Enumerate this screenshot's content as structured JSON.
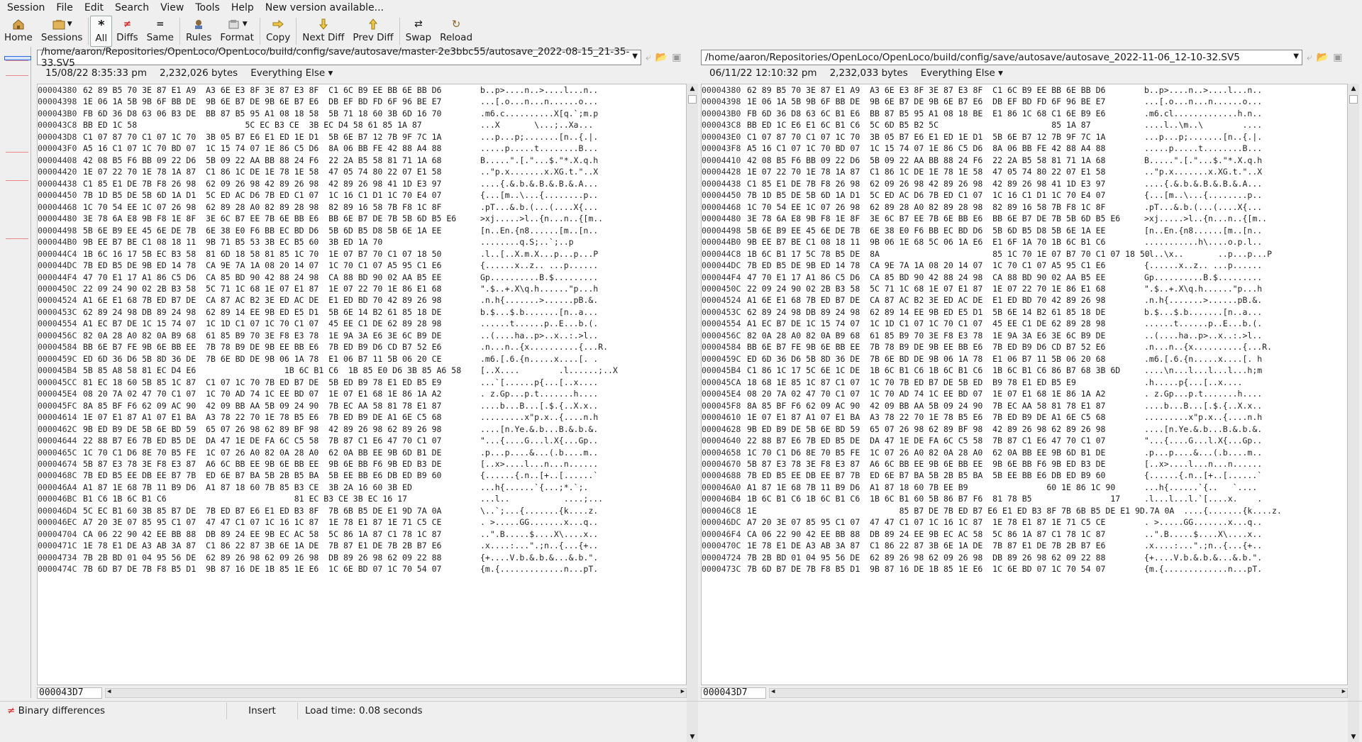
{
  "menu": {
    "items": [
      "Session",
      "File",
      "Edit",
      "Search",
      "View",
      "Tools",
      "Help",
      "New version available..."
    ]
  },
  "toolbar": {
    "buttons": [
      {
        "label": "Home",
        "icon": "house-icon"
      },
      {
        "label": "Sessions",
        "icon": "sessions-icon"
      },
      {
        "label": "All",
        "icon": "asterisk-icon"
      },
      {
        "label": "Diffs",
        "icon": "diffs-icon"
      },
      {
        "label": "Same",
        "icon": "equals-icon"
      },
      {
        "label": "Rules",
        "icon": "rules-icon"
      },
      {
        "label": "Format",
        "icon": "format-icon"
      },
      {
        "label": "Copy",
        "icon": "copy-arrow-icon"
      },
      {
        "label": "Next Diff",
        "icon": "next-diff-icon"
      },
      {
        "label": "Prev Diff",
        "icon": "prev-diff-icon"
      },
      {
        "label": "Swap",
        "icon": "swap-icon"
      },
      {
        "label": "Reload",
        "icon": "reload-icon"
      }
    ],
    "active": "All"
  },
  "left": {
    "path": "/home/aaron/Repositories/OpenLoco/OpenLoco/build/config/save/autosave/master-2e3bbc55/autosave_2022-08-15_21-35-33.SV5",
    "date": "15/08/22 8:35:33 pm",
    "size": "2,232,026 bytes",
    "filter": "Everything Else",
    "offset": "000043D7",
    "rows": [
      [
        "00004380",
        "62 89 B5 70 3E 87 E1 A9  A3 6E E3 8F 3E 87 E3 8F  C1 6C B9 EE BB 6E BB D6",
        "b..p>....n..>....l...n.."
      ],
      [
        "00004398",
        "1E 06 1A 5B 9B 6F BB DE  9B 6E B7 DE 9B 6E B7 E6  DB EF BD FD 6F 96 BE E7",
        "...[.o...n...n......o..."
      ],
      [
        "000043B0",
        "FB 6D 36 D8 63 06 B3 DE  BB 87 B5 95 A1 08 18 58  5B 71 18 60 3B 6D 16 70",
        ".m6.c..........X[q.`;m.p"
      ],
      [
        "000043C8",
        "BB ED 1C 58                      5C EC B3 CE  3B EC D4 58 61 85 1A 87",
        "...X       \\...;..Xa..."
      ],
      [
        "000043D8",
        "C1 07 87 70 C1 07 1C 70  3B 05 B7 E6 E1 ED 1E D1  5B 6E B7 12 7B 9F 7C 1A",
        "...p...p;.......[n..{.|."
      ],
      [
        "000043F0",
        "A5 16 C1 07 1C 70 BD 07  1C 15 74 07 1E 86 C5 D6  8A 06 BB FE 42 88 A4 88",
        ".....p.....t........B..."
      ],
      [
        "00004408",
        "42 08 B5 F6 BB 09 22 D6  5B 09 22 AA BB 88 24 F6  22 2A B5 58 81 71 1A 68",
        "B.....\".[.\"...$.\"*.X.q.h"
      ],
      [
        "00004420",
        "1E 07 22 70 1E 78 1A 87  C1 86 1C DE 1E 78 1E 58  47 05 74 80 22 07 E1 58",
        "..\"p.x.......x.XG.t.\"..X"
      ],
      [
        "00004438",
        "C1 85 E1 DE 7B F8 26 98  62 09 26 98 42 89 26 98  42 89 26 98 41 1D E3 97",
        "....{.&.b.&.B.&.B.&.A..."
      ],
      [
        "00004450",
        "7B 1D B5 DE 5B 6D 1A D1  5C ED AC D6 7B ED C1 07  1C 16 C1 D1 1C 70 E4 07",
        "{...[m..\\...{........p.."
      ],
      [
        "00004468",
        "1C 70 54 EE 1C 07 26 98  62 89 28 A0 82 89 28 98  82 89 16 58 7B F8 1C 8F",
        ".pT...&.b.(...(....X{..."
      ],
      [
        "00004480",
        "3E 78 6A E8 9B F8 1E 8F  3E 6C B7 EE 7B 6E BB E6  BB 6E B7 DE 7B 5B 6D B5 E6",
        ">xj.....>l..{n...n..{[m.."
      ],
      [
        "00004498",
        "5B 6E B9 EE 45 6E DE 7B  6E 38 E0 F6 BB EC BD D6  5B 6D B5 D8 5B 6E 1A EE",
        "[n..En.{n8......[m..[n.."
      ],
      [
        "000044B0",
        "9B EE B7 BE C1 08 18 11  9B 71 B5 53 3B EC B5 60  3B ED 1A 70",
        "........q.S;..`;..p"
      ],
      [
        "000044C4",
        "1B 6C 16 17 5B EC B3 58  81 6D 18 58 81 85 1C 70  1E 07 B7 70 C1 07 18 50",
        ".l..[..X.m.X...p...p...P"
      ],
      [
        "000044DC",
        "7B ED B5 DE 9B ED 14 78  CA 9E 7A 1A 08 20 14 07  1C 70 C1 07 A5 95 C1 E6",
        "{......x..z.. ...p......"
      ],
      [
        "000044F4",
        "47 70 E1 17 A1 86 C5 D6  CA 85 BD 90 42 88 24 98  CA 88 BD 90 02 AA B5 EE",
        "Gp..........B.$........."
      ],
      [
        "0000450C",
        "22 09 24 90 02 2B B3 58  5C 71 1C 68 1E 07 E1 87  1E 07 22 70 1E 86 E1 68",
        "\".$..+.X\\q.h......\"p...h"
      ],
      [
        "00004524",
        "A1 6E E1 68 7B ED B7 DE  CA 87 AC B2 3E ED AC DE  E1 ED BD 70 42 89 26 98",
        ".n.h{.......>......pB.&."
      ],
      [
        "0000453C",
        "62 89 24 98 DB 89 24 98  62 89 14 EE 9B ED E5 D1  5B 6E 14 B2 61 85 18 DE",
        "b.$...$.b.......[n..a..."
      ],
      [
        "00004554",
        "A1 EC B7 DE 1C 15 74 07  1C 1D C1 07 1C 70 C1 07  45 EE C1 DE 62 89 28 98",
        "......t......p..E...b.(."
      ],
      [
        "0000456C",
        "82 0A 28 A0 82 0A B9 68  61 85 B9 70 3E F8 E3 78  1E 9A 3A E6 3E 6C B9 DE",
        "..(....ha..p>..x..:.>l.."
      ],
      [
        "00004584",
        "BB 6E B7 FE 9B 6E BB EE  7B 78 B9 DE 9B EE BB E6  7B ED B9 D6 CD B7 52 E6",
        ".n...n..{x..........{...R."
      ],
      [
        "0000459C",
        "ED 6D 36 D6 5B 8D 36 DE  7B 6E BD DE 9B 06 1A 78  E1 06 B7 11 5B 06 20 CE",
        ".m6.[.6.{n.....x....[. ."
      ],
      [
        "000045B4",
        "5B 85 A8 58 81 EC D4 E6                  1B 6C B1 C6  1B 85 E0 D6 3B 85 A6 58",
        "[..X....        .l......;..X"
      ],
      [
        "000045CC",
        "81 EC 18 60 5B 85 1C 87  C1 07 1C 70 7B ED B7 DE  5B ED B9 78 E1 ED B5 E9",
        "...`[......p{...[..x...."
      ],
      [
        "000045E4",
        "08 20 7A 02 47 70 C1 07  1C 70 AD 74 1C EE BD 07  1E 07 E1 68 1E 86 1A A2",
        ". z.Gp...p.t.......h...."
      ],
      [
        "000045FC",
        "8A 85 BF F6 62 09 AC 90  42 09 BB AA 5B 09 24 90  7B EC AA 58 81 78 E1 87",
        "....b...B...[.$.{..X.x.."
      ],
      [
        "00004614",
        "1E 07 E1 87 A1 07 E1 BA  A3 78 22 70 1E 78 B5 E6  7B ED B9 DE A1 6E C5 68",
        ".........x\"p.x..{....n.h"
      ],
      [
        "0000462C",
        "9B ED B9 DE 5B 6E BD 59  65 07 26 98 62 89 BF 98  42 89 26 98 62 89 26 98",
        "....[n.Ye.&.b...B.&.b.&."
      ],
      [
        "00004644",
        "22 88 B7 E6 7B ED B5 DE  DA 47 1E DE FA 6C C5 58  7B 87 C1 E6 47 70 C1 07",
        "\"...{....G...l.X{...Gp.."
      ],
      [
        "0000465C",
        "1C 70 C1 D6 8E 70 B5 FE  1C 07 26 A0 82 0A 28 A0  62 0A BB EE 9B 6D B1 DE",
        ".p...p....&...(.b....m.."
      ],
      [
        "00004674",
        "5B 87 E3 78 3E F8 E3 87  A6 6C BB EE 9B 6E BB EE  9B 6E BB F6 9B ED B3 DE",
        "[..x>....l...n...n......"
      ],
      [
        "0000468C",
        "7B ED B5 EE DB EE B7 7B  ED 6E B7 BA 5B 2B B5 BA  5B EE BB E6 DB ED B9 60",
        "{......{.n..[+..[......`"
      ],
      [
        "000046A4",
        "A1 87 1E 68 7B 11 B9 D6  A1 87 18 60 7B 85 B3 CE  3B 2A 16 60 3B ED",
        "...h{......`{...;*.`;."
      ],
      [
        "000046BC",
        "B1 C6 1B 6C B1 C6                          81 EC B3 CE 3B EC 16 17",
        "...l..           ....;..."
      ],
      [
        "000046D4",
        "5C EC B1 60 3B 85 B7 DE  7B ED B7 E6 E1 ED B3 8F  7B 6B B5 DE E1 9D 7A 0A",
        "\\..`;...{.......{k....z."
      ],
      [
        "000046EC",
        "A7 20 3E 07 85 95 C1 07  47 47 C1 07 1C 16 1C 87  1E 78 E1 87 1E 71 C5 CE",
        ". >.....GG.......x...q.."
      ],
      [
        "00004704",
        "CA 06 22 90 42 EE BB 88  DB 89 24 EE 9B EC AC 58  5C 86 1A 87 C1 78 1C 87",
        "..\".B.....$....X\\....x.."
      ],
      [
        "0000471C",
        "1E 78 E1 DE A3 AB 3A 87  C1 86 22 87 3B 6E 1A DE  7B 87 E1 DE 7B 2B B7 E6",
        ".x....:...\".;n..{...{+.."
      ],
      [
        "00004734",
        "7B 2B BD 01 04 95 56 DE  62 89 26 98 62 09 26 98  DB 89 26 98 62 09 22 88",
        "{+....V.b.&.b.&...&.b.\"."
      ],
      [
        "0000474C",
        "7B 6D B7 DE 7B F8 B5 D1  9B 87 16 DE 1B 85 1E E6  1C 6E BD 07 1C 70 54 07",
        "{m.{.............n...pT."
      ]
    ]
  },
  "right": {
    "path": "/home/aaron/Repositories/OpenLoco/OpenLoco/build/config/save/autosave/autosave_2022-11-06_12-10-32.SV5",
    "date": "06/11/22 12:10:32 pm",
    "size": "2,232,033 bytes",
    "filter": "Everything Else",
    "offset": "000043D7",
    "rows": [
      [
        "00004380",
        "62 89 B5 70 3E 87 E1 A9  A3 6E E3 8F 3E 87 E3 8F  C1 6C B9 EE BB 6E BB D6",
        "b..p>....n..>....l...n.."
      ],
      [
        "00004398",
        "1E 06 1A 5B 9B 6F BB DE  9B 6E B7 DE 9B 6E B7 E6  DB EF BD FD 6F 96 BE E7",
        "...[.o...n...n......o..."
      ],
      [
        "000043B0",
        "FB 6D 36 D8 63 6C B1 E6  BB 87 B5 95 A1 08 18 BE  E1 86 1C 68 C1 6E B9 E6",
        ".m6.cl.............h.n.."
      ],
      [
        "000043C8",
        "BB ED 1C E6 E1 6C B1 C6  5C 6D B5 B2 5C                       85 1A 87",
        "....l..\\m..\\        ...."
      ],
      [
        "000043E0",
        "C1 07 87 70 C1 07 1C 70  3B 05 B7 E6 E1 ED 1E D1  5B 6E B7 12 7B 9F 7C 1A",
        "...p...p;.......[n..{.|."
      ],
      [
        "000043F8",
        "A5 16 C1 07 1C 70 BD 07  1C 15 74 07 1E 86 C5 D6  8A 06 BB FE 42 88 A4 88",
        ".....p.....t........B..."
      ],
      [
        "00004410",
        "42 08 B5 F6 BB 09 22 D6  5B 09 22 AA BB 88 24 F6  22 2A B5 58 81 71 1A 68",
        "B.....\".[.\"...$.\"*.X.q.h"
      ],
      [
        "00004428",
        "1E 07 22 70 1E 78 1A 87  C1 86 1C DE 1E 78 1E 58  47 05 74 80 22 07 E1 58",
        "..\"p.x.......x.XG.t.\"..X"
      ],
      [
        "00004438",
        "C1 85 E1 DE 7B F8 26 98  62 09 26 98 42 89 26 98  42 89 26 98 41 1D E3 97",
        "....{.&.b.&.B.&.B.&.A..."
      ],
      [
        "00004450",
        "7B 1D B5 DE 5B 6D 1A D1  5C ED AC D6 7B ED C1 07  1C 16 C1 D1 1C 70 E4 07",
        "{...[m..\\...{........p.."
      ],
      [
        "00004468",
        "1C 70 54 EE 1C 07 26 98  62 89 28 A0 82 89 28 98  82 89 16 58 7B F8 1C 8F",
        ".pT...&.b.(...(....X{..."
      ],
      [
        "00004480",
        "3E 78 6A E8 9B F8 1E 8F  3E 6C B7 EE 7B 6E BB E6  BB 6E B7 DE 7B 5B 6D B5 E6",
        ">xj.....>l..{n...n..{[m.."
      ],
      [
        "00004498",
        "5B 6E B9 EE 45 6E DE 7B  6E 38 E0 F6 BB EC BD D6  5B 6D B5 D8 5B 6E 1A EE",
        "[n..En.{n8......[m..[n.."
      ],
      [
        "000044B0",
        "9B EE B7 BE C1 08 18 11  9B 06 1E 68 5C 06 1A E6  E1 6F 1A 70 1B 6C B1 C6",
        "...........h\\....o.p.l.."
      ],
      [
        "000044C8",
        "1B 6C B1 17 5C 78 B5 DE  8A                       85 1C 70 1E 07 B7 70 C1 07 18 50",
        ".l..\\x..       ..p...p...P"
      ],
      [
        "000044DC",
        "7B ED B5 DE 9B ED 14 78  CA 9E 7A 1A 08 20 14 07  1C 70 C1 07 A5 95 C1 E6",
        "{......x..z.. ...p......"
      ],
      [
        "000044F4",
        "47 70 E1 17 A1 86 C5 D6  CA 85 BD 90 42 88 24 98  CA 88 BD 90 02 AA B5 EE",
        "Gp..........B.$........."
      ],
      [
        "0000450C",
        "22 09 24 90 02 2B B3 58  5C 71 1C 68 1E 07 E1 87  1E 07 22 70 1E 86 E1 68",
        "\".$..+.X\\q.h......\"p...h"
      ],
      [
        "00004524",
        "A1 6E E1 68 7B ED B7 DE  CA 87 AC B2 3E ED AC DE  E1 ED BD 70 42 89 26 98",
        ".n.h{.......>......pB.&."
      ],
      [
        "0000453C",
        "62 89 24 98 DB 89 24 98  62 89 14 EE 9B ED E5 D1  5B 6E 14 B2 61 85 18 DE",
        "b.$...$.b.......[n..a..."
      ],
      [
        "00004554",
        "A1 EC B7 DE 1C 15 74 07  1C 1D C1 07 1C 70 C1 07  45 EE C1 DE 62 89 28 98",
        "......t......p..E...b.(."
      ],
      [
        "0000456C",
        "82 0A 28 A0 82 0A B9 68  61 85 B9 70 3E F8 E3 78  1E 9A 3A E6 3E 6C B9 DE",
        "..(....ha..p>..x..:.>l.."
      ],
      [
        "00004584",
        "BB 6E B7 FE 9B 6E BB EE  7B 78 B9 DE 9B EE BB E6  7B ED B9 D6 CD B7 52 E6",
        ".n...n..{x..........{...R."
      ],
      [
        "0000459C",
        "ED 6D 36 D6 5B 8D 36 DE  7B 6E BD DE 9B 06 1A 78  E1 06 B7 11 5B 06 20 68",
        ".m6.[.6.{n.....x....[. h"
      ],
      [
        "000045B4",
        "C1 86 1C 17 5C 6E 1C DE  1B 6C B1 C6 1B 6C B1 C6  1B 6C B1 C6 86 B7 68 3B 6D",
        "....\\n...l...l...l...h;m"
      ],
      [
        "000045CA",
        "18 68 1E 85 1C 87 C1 07  1C 70 7B ED B7 DE 5B ED  B9 78 E1 ED B5 E9",
        ".h.....p{...[..x...."
      ],
      [
        "000045E4",
        "08 20 7A 02 47 70 C1 07  1C 70 AD 74 1C EE BD 07  1E 07 E1 68 1E 86 1A A2",
        ". z.Gp...p.t.......h...."
      ],
      [
        "000045F8",
        "8A 85 BF F6 62 09 AC 90  42 09 BB AA 5B 09 24 90  7B EC AA 58 81 78 E1 87",
        "....b...B...[.$.{..X.x.."
      ],
      [
        "00004610",
        "1E 07 E1 87 A1 07 E1 BA  A3 78 22 70 1E 78 B5 E6  7B ED B9 DE A1 6E C5 68",
        ".........x\"p.x..{....n.h"
      ],
      [
        "00004628",
        "9B ED B9 DE 5B 6E BD 59  65 07 26 98 62 89 BF 98  42 89 26 98 62 89 26 98",
        "....[n.Ye.&.b...B.&.b.&."
      ],
      [
        "00004640",
        "22 88 B7 E6 7B ED B5 DE  DA 47 1E DE FA 6C C5 58  7B 87 C1 E6 47 70 C1 07",
        "\"...{....G...l.X{...Gp.."
      ],
      [
        "00004658",
        "1C 70 C1 D6 8E 70 B5 FE  1C 07 26 A0 82 0A 28 A0  62 0A BB EE 9B 6D B1 DE",
        ".p...p....&...(.b....m.."
      ],
      [
        "00004670",
        "5B 87 E3 78 3E F8 E3 87  A6 6C BB EE 9B 6E BB EE  9B 6E BB F6 9B ED B3 DE",
        "[..x>....l...n...n......"
      ],
      [
        "00004688",
        "7B ED B5 EE DB EE B7 7B  ED 6E B7 BA 5B 2B B5 BA  5B EE BB E6 DB ED B9 60",
        "{......{.n..[+..[......`"
      ],
      [
        "000046A0",
        "A1 87 1E 68 7B 11 B9 D6  A1 87 18 60 7B EE B9                60 1E 86 1C 90",
        "...h{......`{..   `...."
      ],
      [
        "000046B4",
        "1B 6C B1 C6 1B 6C B1 C6  1B 6C B1 60 5B 86 B7 F6  81 78 B5                17",
        ".l...l...l.`[....x.    ."
      ],
      [
        "000046C8",
        "1E                             85 B7 DE 7B ED B7 E6 E1 ED B3 8F 7B 6B B5 DE E1 9D 7A 0A",
        ".       ....{.......{k....z."
      ],
      [
        "000046DC",
        "A7 20 3E 07 85 95 C1 07  47 47 C1 07 1C 16 1C 87  1E 78 E1 87 1E 71 C5 CE",
        ". >.....GG.......x...q.."
      ],
      [
        "000046F4",
        "CA 06 22 90 42 EE BB 88  DB 89 24 EE 9B EC AC 58  5C 86 1A 87 C1 78 1C 87",
        "..\".B.....$....X\\....x.."
      ],
      [
        "0000470C",
        "1E 78 E1 DE A3 AB 3A 87  C1 86 22 87 3B 6E 1A DE  7B 87 E1 DE 7B 2B B7 E6",
        ".x....:...\".;n..{...{+.."
      ],
      [
        "00004724",
        "7B 2B BD 01 04 95 56 DE  62 89 26 98 62 09 26 98  DB 89 26 98 62 09 22 88",
        "{+....V.b.&.b.&...&.b.\"."
      ],
      [
        "0000473C",
        "7B 6D B7 DE 7B F8 B5 D1  9B 87 16 DE 1B 85 1E E6  1C 6E BD 07 1C 70 54 07",
        "{m.{.............n...pT."
      ]
    ]
  },
  "status": {
    "mode": "Binary differences",
    "insert": "Insert",
    "load": "Load time: 0.08 seconds"
  }
}
